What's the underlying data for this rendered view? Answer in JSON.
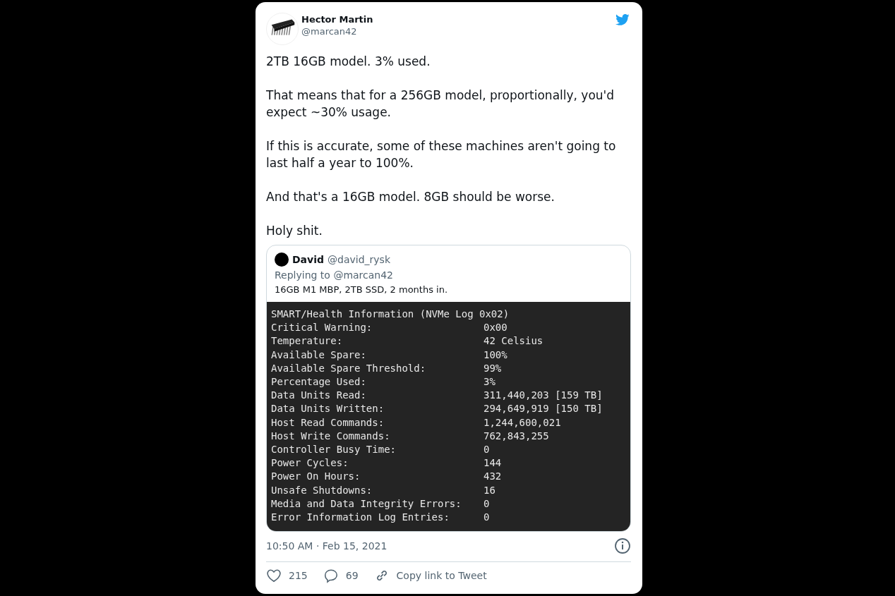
{
  "author": {
    "name": "Hector Martin",
    "handle": "@marcan42"
  },
  "paragraphs": [
    "2TB 16GB model. 3% used.",
    "That means that for a 256GB model, proportionally, you'd expect ~30% usage.",
    "If this is accurate, some of these machines aren't going to last half a year to 100%.",
    "And that's a 16GB model. 8GB should be worse.",
    "Holy shit."
  ],
  "quoted": {
    "name": "David",
    "handle": "@david_rysk",
    "replying_label": "Replying to",
    "replying_to": "@marcan42",
    "text": "16GB M1 MBP, 2TB SSD, 2 months in.",
    "terminal": {
      "title": "SMART/Health Information (NVMe Log 0x02)",
      "rows": [
        {
          "label": "Critical Warning:",
          "value": "0x00"
        },
        {
          "label": "Temperature:",
          "value": "42 Celsius"
        },
        {
          "label": "Available Spare:",
          "value": "100%"
        },
        {
          "label": "Available Spare Threshold:",
          "value": "99%"
        },
        {
          "label": "Percentage Used:",
          "value": "3%"
        },
        {
          "label": "Data Units Read:",
          "value": "311,440,203 [159 TB]"
        },
        {
          "label": "Data Units Written:",
          "value": "294,649,919 [150 TB]"
        },
        {
          "label": "Host Read Commands:",
          "value": "1,244,600,021"
        },
        {
          "label": "Host Write Commands:",
          "value": "762,843,255"
        },
        {
          "label": "Controller Busy Time:",
          "value": "0"
        },
        {
          "label": "Power Cycles:",
          "value": "144"
        },
        {
          "label": "Power On Hours:",
          "value": "432"
        },
        {
          "label": "Unsafe Shutdowns:",
          "value": "16"
        },
        {
          "label": "Media and Data Integrity Errors:",
          "value": "0"
        },
        {
          "label": "Error Information Log Entries:",
          "value": "0"
        }
      ]
    }
  },
  "timestamp": "10:50 AM · Feb 15, 2021",
  "actions": [
    {
      "kind": "like",
      "label": "215"
    },
    {
      "kind": "reply",
      "label": "69"
    },
    {
      "kind": "link",
      "label": "Copy link to Tweet"
    }
  ]
}
